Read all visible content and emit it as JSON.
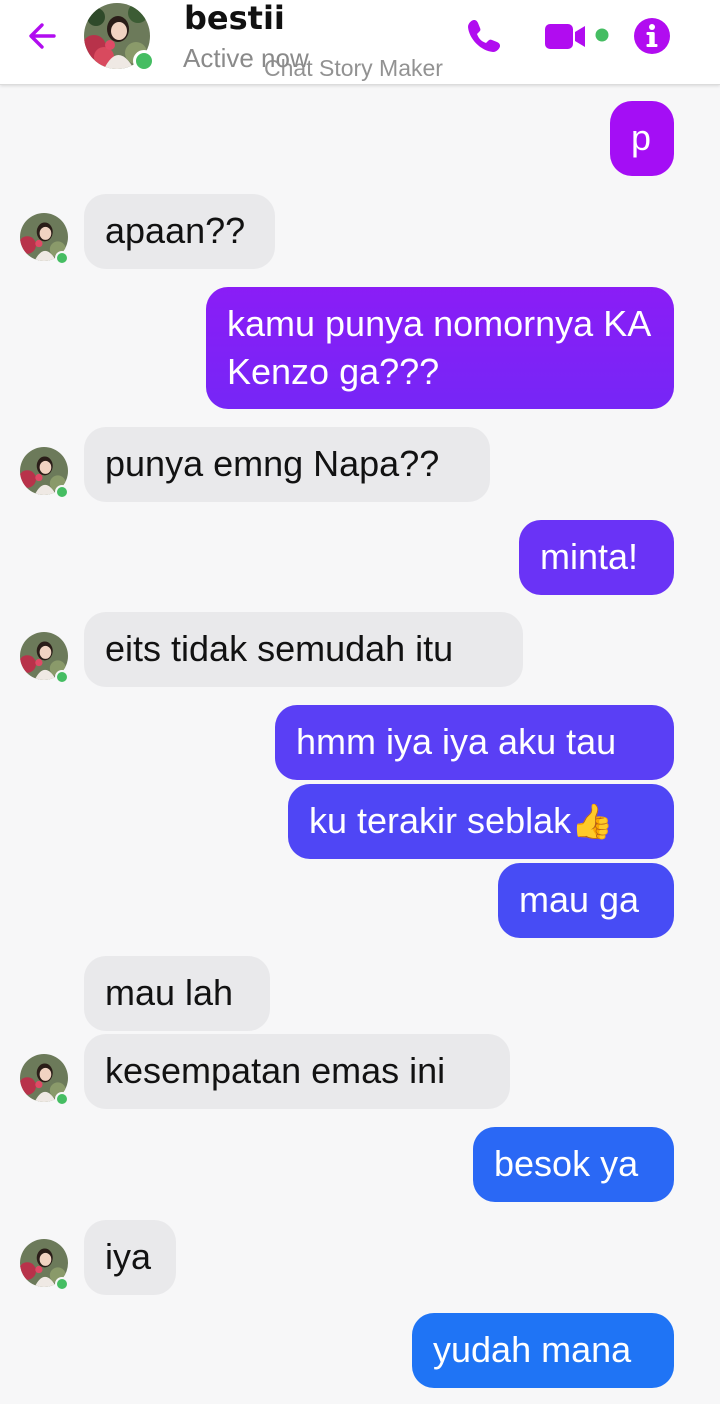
{
  "header": {
    "contact_name": "bestii",
    "status": "Active now",
    "watermark": "Chat Story Maker",
    "icons": {
      "back": "arrow-left-icon",
      "phone": "phone-icon",
      "video": "video-camera-icon",
      "info": "info-icon"
    },
    "accent_color": "#b10cf0",
    "online_color": "#45bd62"
  },
  "messages": [
    {
      "sender": "me",
      "text": "p"
    },
    {
      "sender": "bestii",
      "text": "apaan??"
    },
    {
      "sender": "me",
      "text": "kamu punya nomornya KA Kenzo ga???"
    },
    {
      "sender": "bestii",
      "text": "punya emng Napa??"
    },
    {
      "sender": "me",
      "text": "minta!"
    },
    {
      "sender": "bestii",
      "text": "eits tidak semudah itu"
    },
    {
      "sender": "me",
      "text": "hmm iya iya aku tau"
    },
    {
      "sender": "me",
      "text": "ku terakir seblak",
      "emoji": "👍"
    },
    {
      "sender": "me",
      "text": "mau ga"
    },
    {
      "sender": "bestii",
      "text": "mau lah"
    },
    {
      "sender": "bestii",
      "text": "kesempatan emas ini"
    },
    {
      "sender": "me",
      "text": "besok ya"
    },
    {
      "sender": "bestii",
      "text": "iya"
    },
    {
      "sender": "me",
      "text": "yudah mana"
    }
  ],
  "colors": {
    "received_bubble": "#e9e9eb",
    "sent_gradient": [
      "#a20ef5",
      "#7a2df7",
      "#4a4cf4",
      "#1e72f5"
    ]
  }
}
